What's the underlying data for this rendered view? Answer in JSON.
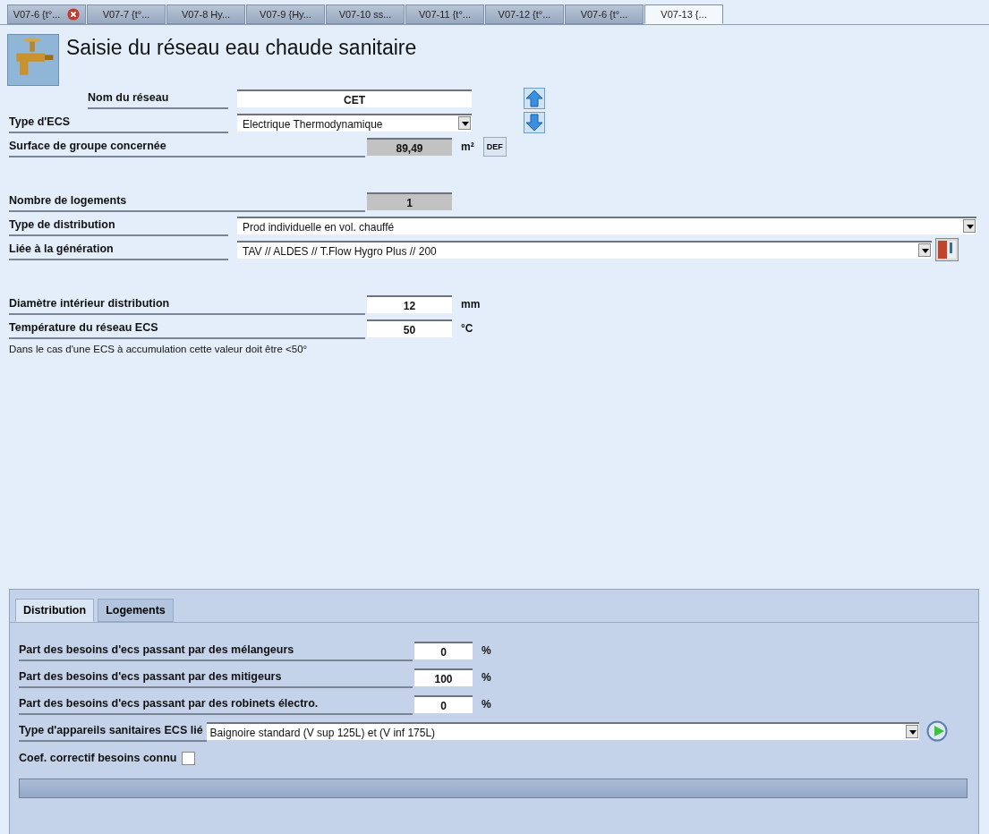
{
  "doc_tabs": [
    {
      "label": "V07-6 {t°...",
      "selected": false,
      "closable": true
    },
    {
      "label": "V07-7 {t°...",
      "selected": false,
      "closable": false
    },
    {
      "label": "V07-8 Hy...",
      "selected": false,
      "closable": false
    },
    {
      "label": "V07-9 {Hy...",
      "selected": false,
      "closable": false
    },
    {
      "label": "V07-10 ss...",
      "selected": false,
      "closable": false
    },
    {
      "label": "V07-11 {t°...",
      "selected": false,
      "closable": false
    },
    {
      "label": "V07-12 {t°...",
      "selected": false,
      "closable": false
    },
    {
      "label": "V07-6 {t°...",
      "selected": false,
      "closable": false
    },
    {
      "label": "V07-13 {...",
      "selected": true,
      "closable": false
    }
  ],
  "title": "Saisie du réseau eau chaude sanitaire",
  "groups": [
    [
      {
        "kind": "name",
        "label": "Nom du réseau",
        "value": "CET",
        "side_icon": {
          "kind": "up"
        }
      },
      {
        "kind": "select",
        "label": "Type d'ECS",
        "value": "Electrique Thermodynamique",
        "side_icon": {
          "kind": "down"
        }
      },
      {
        "kind": "readonly",
        "label": "Surface de groupe concernée",
        "value": "89,49",
        "unit": "m²",
        "button": "DEF"
      }
    ],
    [
      {
        "kind": "readonly",
        "label": "Nombre de logements",
        "value": "1"
      },
      {
        "kind": "select-wide",
        "label": "Type de distribution",
        "value": "Prod individuelle en vol. chauffé"
      },
      {
        "kind": "select-wide",
        "label": "Liée à la génération",
        "value": "TAV // ALDES // T.Flow Hygro Plus // 200",
        "side_icon": {
          "kind": "generator"
        }
      }
    ],
    [
      {
        "kind": "number",
        "label": "Diamètre intérieur distribution",
        "value": "12",
        "unit": "mm"
      },
      {
        "kind": "number",
        "label": "Température du réseau ECS",
        "value": "50",
        "unit": "°C"
      }
    ]
  ],
  "note": "Dans le cas d'une ECS à accumulation cette valeur doit être <50°",
  "panel": {
    "tabs": [
      {
        "label": "Distribution",
        "selected": true
      },
      {
        "label": "Logements",
        "selected": false
      }
    ],
    "rows": [
      {
        "kind": "number",
        "label": "Part des besoins d'ecs passant par des mélangeurs",
        "value": "0",
        "unit": "%"
      },
      {
        "kind": "number",
        "label": "Part des besoins d'ecs passant par des mitigeurs",
        "value": "100",
        "unit": "%"
      },
      {
        "kind": "number",
        "label": "Part des besoins d'ecs passant par des robinets électro.",
        "value": "0",
        "unit": "%"
      },
      {
        "kind": "select",
        "label": "Type d'appareils sanitaires ECS lié",
        "value": "Baignoire standard (V sup 125L) et (V inf 175L)"
      },
      {
        "kind": "checkbox",
        "label": "Coef. correctif besoins connu",
        "checked": false
      }
    ]
  }
}
